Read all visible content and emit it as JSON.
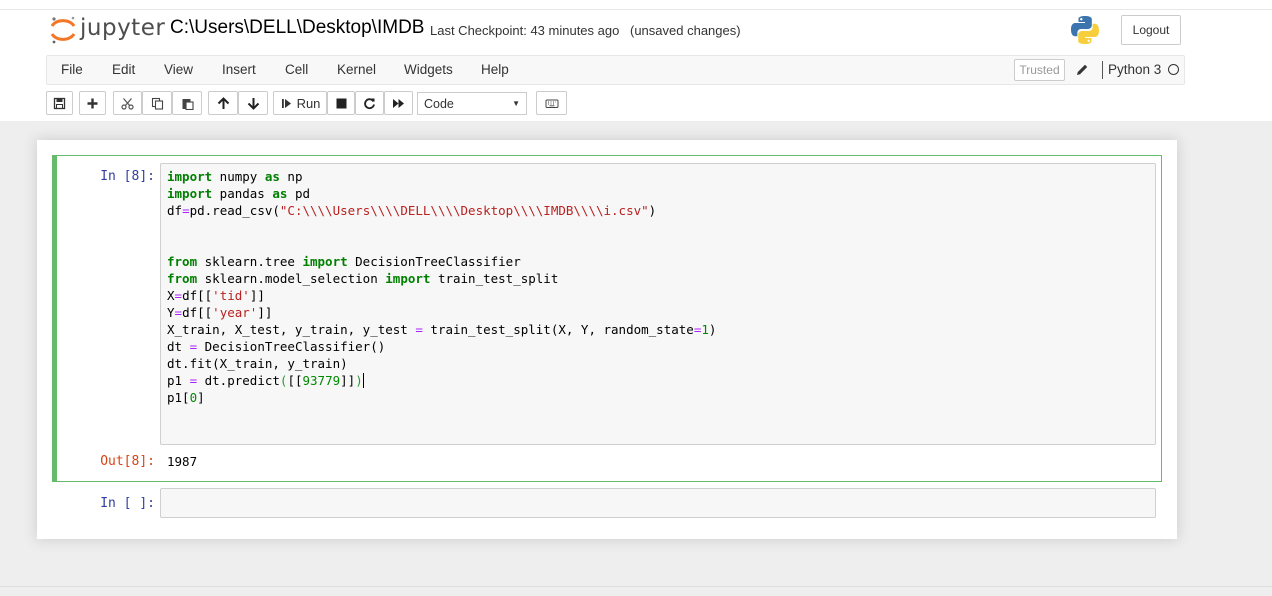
{
  "header": {
    "logo_text": "jupyter",
    "notebook_name": "C:\\Users\\DELL\\Desktop\\IMDB",
    "checkpoint": "Last Checkpoint: 43 minutes ago",
    "autosave_status": "(unsaved changes)",
    "logout_label": "Logout"
  },
  "menubar": {
    "items": [
      "File",
      "Edit",
      "View",
      "Insert",
      "Cell",
      "Kernel",
      "Widgets",
      "Help"
    ],
    "trusted_label": "Trusted",
    "kernel_name": "Python 3"
  },
  "toolbar": {
    "icons": [
      "save-icon",
      "plus-icon",
      "cut-icon",
      "copy-icon",
      "paste-icon",
      "arrow-up-icon",
      "arrow-down-icon",
      "step-forward-icon",
      "stop-icon",
      "restart-icon",
      "fast-forward-icon",
      "keyboard-icon"
    ],
    "run_label": "Run",
    "cell_type": "Code"
  },
  "cells": [
    {
      "in_prompt": "In [8]:",
      "code_lines": [
        "import numpy as np",
        "import pandas as pd",
        "df=pd.read_csv(\"C:\\\\Users\\\\DELL\\\\Desktop\\\\IMDB\\\\i.csv\")",
        "",
        "",
        "from sklearn.tree import DecisionTreeClassifier",
        "from sklearn.model_selection import train_test_split",
        "X=df[['tid']]",
        "Y=df[['year']]",
        "X_train, X_test, y_train, y_test = train_test_split(X, Y, random_state=1)",
        "dt = DecisionTreeClassifier()",
        "dt.fit(X_train, y_train)",
        "p1 = dt.predict([[93779]])",
        "p1[0]"
      ],
      "out_prompt": "Out[8]:",
      "output": "1987"
    },
    {
      "in_prompt": "In [ ]:",
      "code_lines": []
    }
  ],
  "colors": {
    "selected_cell_border": "#66bb6a",
    "in_prompt": "#303f9f",
    "out_prompt": "#d84315",
    "keyword": "#008000",
    "string": "#ba2121"
  }
}
